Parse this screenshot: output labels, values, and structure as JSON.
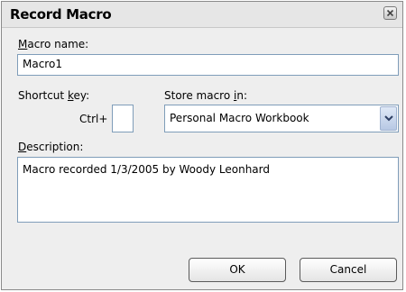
{
  "dialog": {
    "title": "Record Macro",
    "close_icon": "close-icon"
  },
  "macro_name": {
    "label_prefix": "",
    "label_hotkey": "M",
    "label_rest": "acro name:",
    "value": "Macro1"
  },
  "shortcut": {
    "label_prefix": "Shortcut ",
    "label_hotkey": "k",
    "label_rest": "ey:",
    "ctrl_text": "Ctrl+",
    "value": ""
  },
  "store": {
    "label_prefix": "Store macro ",
    "label_hotkey": "i",
    "label_rest": "n:",
    "selected": "Personal Macro Workbook",
    "arrow_icon": "chevron-down-icon"
  },
  "description": {
    "label_prefix": "",
    "label_hotkey": "D",
    "label_rest": "escription:",
    "value": "Macro recorded 1/3/2005 by Woody Leonhard"
  },
  "buttons": {
    "ok": "OK",
    "cancel": "Cancel"
  }
}
